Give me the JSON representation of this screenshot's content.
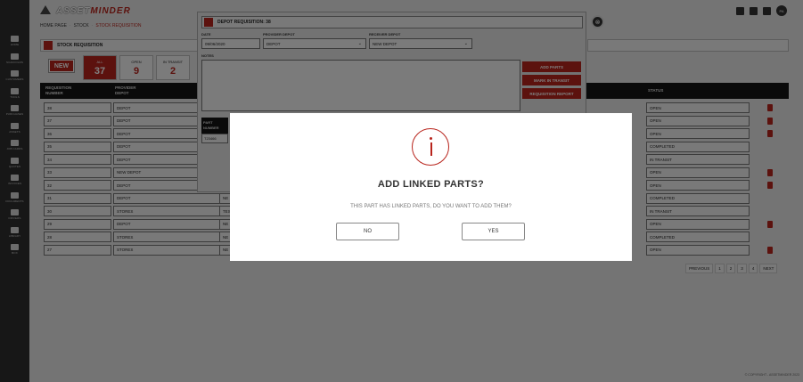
{
  "app": {
    "logo_part1": "ASSET",
    "logo_part2": "MINDER"
  },
  "breadcrumb": [
    "HOME PAGE",
    "STOCK",
    "STOCK REQUISITION"
  ],
  "user": {
    "initials": "PA"
  },
  "sidebar": {
    "items": [
      {
        "label": "HOME",
        "icon": "home-icon"
      },
      {
        "label": "SCAFFOLDS",
        "icon": "scaffold-icon"
      },
      {
        "label": "CUSTOMERS",
        "icon": "customers-icon"
      },
      {
        "label": "TOOLS",
        "icon": "tools-icon"
      },
      {
        "label": "PURCHASES",
        "icon": "purchases-icon"
      },
      {
        "label": "ASSETS",
        "icon": "assets-icon"
      },
      {
        "label": "JOB CARDS",
        "icon": "jobcards-icon"
      },
      {
        "label": "QUOTES",
        "icon": "quotes-icon"
      },
      {
        "label": "INVOICES",
        "icon": "invoices-icon"
      },
      {
        "label": "DOCUMENTS",
        "icon": "documents-icon"
      },
      {
        "label": "DRIVERS",
        "icon": "drivers-icon"
      },
      {
        "label": "LIBRARY",
        "icon": "library-icon"
      },
      {
        "label": "BOX",
        "icon": "box-icon"
      }
    ]
  },
  "page": {
    "section_title": "STOCK REQUISITION",
    "new_label": "NEW",
    "stats": [
      {
        "label": "ALL",
        "value": "37",
        "active": true
      },
      {
        "label": "OPEN",
        "value": "9",
        "active": false
      },
      {
        "label": "IN TRANSIT",
        "value": "2",
        "active": false
      }
    ],
    "columns": {
      "number": [
        "REQUISITION",
        "NUMBER"
      ],
      "provider": [
        "PROVIDER",
        "DEPOT"
      ],
      "status": "STATUS"
    },
    "rows": [
      {
        "number": "38",
        "provider": "DEPOT",
        "receiver": "",
        "status": "OPEN",
        "trash": true
      },
      {
        "number": "37",
        "provider": "DEPOT",
        "receiver": "",
        "status": "OPEN",
        "trash": true
      },
      {
        "number": "36",
        "provider": "DEPOT",
        "receiver": "",
        "status": "OPEN",
        "trash": true
      },
      {
        "number": "35",
        "provider": "DEPOT",
        "receiver": "",
        "status": "COMPLETED",
        "trash": false
      },
      {
        "number": "34",
        "provider": "DEPOT",
        "receiver": "",
        "status": "IN TRANSIT",
        "trash": false
      },
      {
        "number": "33",
        "provider": "NEW DEPOT",
        "receiver": "",
        "status": "OPEN",
        "trash": true
      },
      {
        "number": "32",
        "provider": "DEPOT",
        "receiver": "",
        "status": "OPEN",
        "trash": true
      },
      {
        "number": "31",
        "provider": "DEPOT",
        "receiver": "NE",
        "status": "COMPLETED",
        "trash": false
      },
      {
        "number": "30",
        "provider": "STORES",
        "receiver": "TES",
        "status": "IN TRANSIT",
        "trash": false
      },
      {
        "number": "29",
        "provider": "DEPOT",
        "receiver": "NE",
        "status": "OPEN",
        "trash": true
      },
      {
        "number": "28",
        "provider": "STORES",
        "receiver": "NE",
        "status": "COMPLETED",
        "trash": false
      },
      {
        "number": "27",
        "provider": "STORES",
        "receiver": "NE",
        "status": "OPEN",
        "trash": true
      }
    ],
    "pager": [
      "PREVIOUS",
      "1",
      "2",
      "3",
      "4",
      "NEXT"
    ],
    "copyright": "© COPYRIGHT - ASSETMINDER 2023"
  },
  "panel": {
    "title": "DEPOT REQUISITION: 38",
    "date_label": "DATE",
    "date_value": "09/06/2020",
    "provider_label": "PROVIDER DEPOT",
    "provider_value": "DEPOT",
    "receiver_label": "RECEIVER DEPOT",
    "receiver_value": "NEW DEPOT",
    "notes_label": "NOTES",
    "buttons": [
      "ADD PARTS",
      "MARK IN TRANSIT",
      "REQUISITION REPORT"
    ],
    "part_header": [
      "PART",
      "NUMBER"
    ],
    "part_value": "T23466"
  },
  "modal": {
    "title": "ADD LINKED PARTS?",
    "message": "THIS PART HAS LINKED PARTS, DO YOU WANT TO ADD THEM?",
    "no_label": "NO",
    "yes_label": "YES",
    "accent": "#b8241c"
  }
}
